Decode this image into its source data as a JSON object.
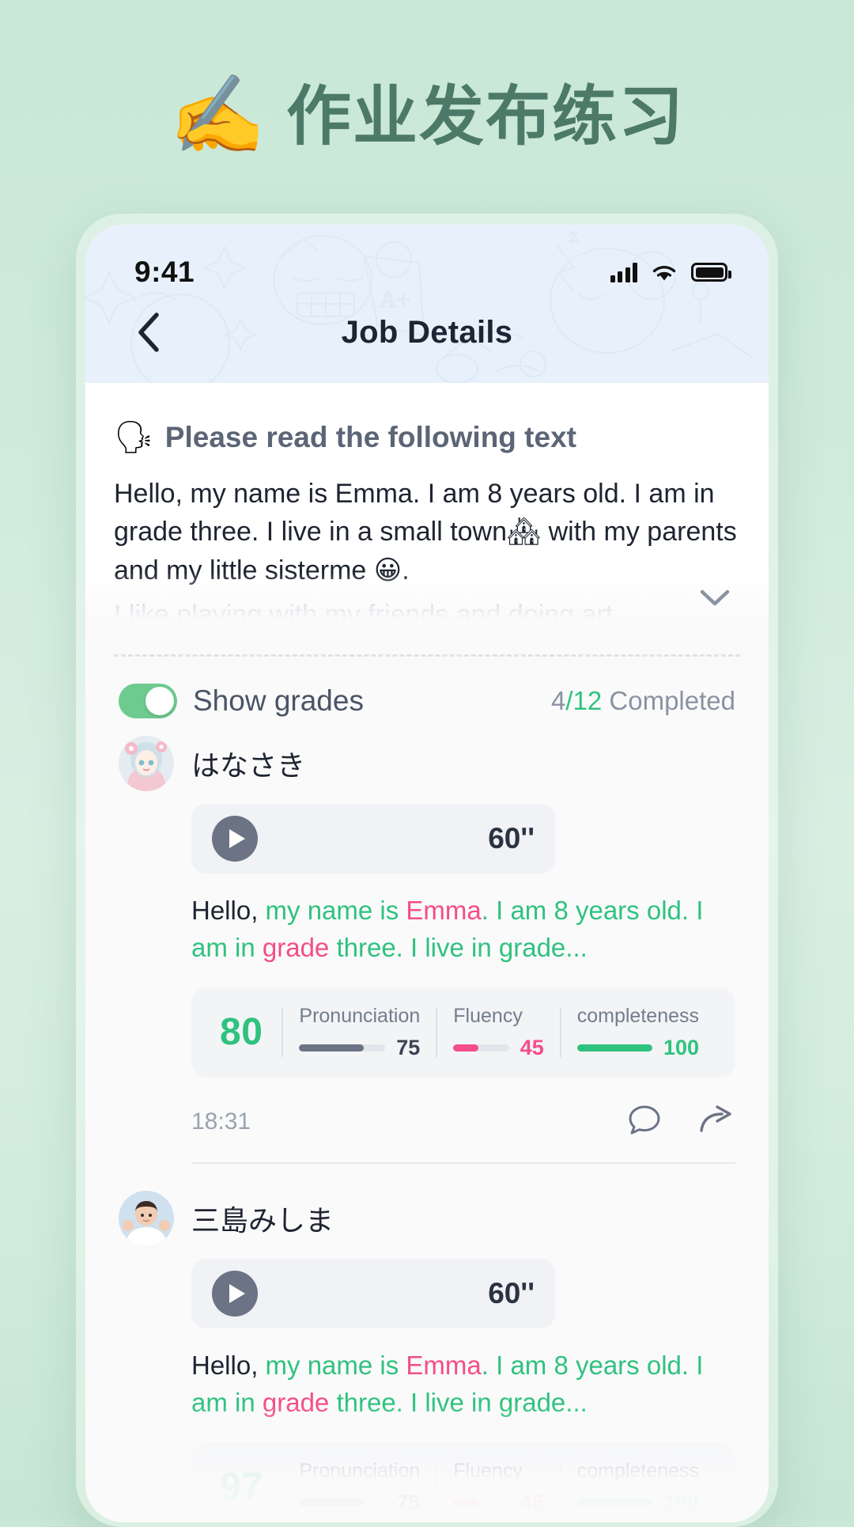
{
  "page": {
    "title": "作业发布练习",
    "title_emoji": "✍️"
  },
  "statusbar": {
    "time": "9:41",
    "signal_icon": "cellular-signal-icon",
    "wifi_icon": "wifi-icon",
    "battery_icon": "battery-full-icon"
  },
  "navbar": {
    "back_icon": "back-chevron-icon",
    "title": "Job Details"
  },
  "reading": {
    "head_emoji": "🗣",
    "head_text": "Please read the following text",
    "body": "Hello, my name is Emma. I am 8 years old. I am in grade three. I live in a small town🏘 with my parents and my little sisterme 😀.",
    "faded_line": "I like playing with my friends and doing art",
    "expand_icon": "chevron-down-icon"
  },
  "controls": {
    "toggle_label": "Show grades",
    "toggle_on": true,
    "completed_done": "4",
    "completed_total": "/12",
    "completed_suffix": " Completed"
  },
  "metric_labels": {
    "pronunciation": "Pronunciation",
    "fluency": "Fluency",
    "completeness": "completeness"
  },
  "colors": {
    "accent_green": "#2fc27e",
    "accent_pink": "#f54d87",
    "bar_dark": "#6b7385",
    "page_bg": "#cfeadb",
    "header_blue": "#e8f1fb",
    "title_green": "#4d7a68"
  },
  "icons": {
    "play": "play-icon",
    "comment": "comment-bubble-icon",
    "share": "share-arrow-icon"
  },
  "students": [
    {
      "name": "はなさき",
      "avatar_kind": "anime-girl-avatar",
      "duration": "60''",
      "transcript": [
        {
          "text": "Hello,",
          "color": "dark"
        },
        {
          "text": " my name is ",
          "color": "green"
        },
        {
          "text": "Emma",
          "color": "pink"
        },
        {
          "text": ". I am 8 years old. I am in ",
          "color": "green"
        },
        {
          "text": "grade",
          "color": "pink"
        },
        {
          "text": " three. I live in grade...",
          "color": "green"
        }
      ],
      "score": "80",
      "metrics": [
        {
          "key": "pronunciation",
          "value": "75",
          "pct": 75,
          "color": "#6b7385"
        },
        {
          "key": "fluency",
          "value": "45",
          "pct": 45,
          "color": "#f54d87"
        },
        {
          "key": "completeness",
          "value": "100",
          "pct": 100,
          "color": "#2fc27e"
        }
      ],
      "time": "18:31"
    },
    {
      "name": "三島みしま",
      "avatar_kind": "photo-person-avatar",
      "duration": "60''",
      "transcript": [
        {
          "text": "Hello,",
          "color": "dark"
        },
        {
          "text": " my name is ",
          "color": "green"
        },
        {
          "text": "Emma",
          "color": "pink"
        },
        {
          "text": ". I am 8 years old. I am in ",
          "color": "green"
        },
        {
          "text": "grade",
          "color": "pink"
        },
        {
          "text": " three. I live in grade...",
          "color": "green"
        }
      ],
      "score": "97",
      "metrics": [
        {
          "key": "pronunciation",
          "value": "75",
          "pct": 75,
          "color": "#6b7385"
        },
        {
          "key": "fluency",
          "value": "45",
          "pct": 45,
          "color": "#f54d87"
        },
        {
          "key": "completeness",
          "value": "100",
          "pct": 100,
          "color": "#2fc27e"
        }
      ],
      "time": ""
    }
  ]
}
